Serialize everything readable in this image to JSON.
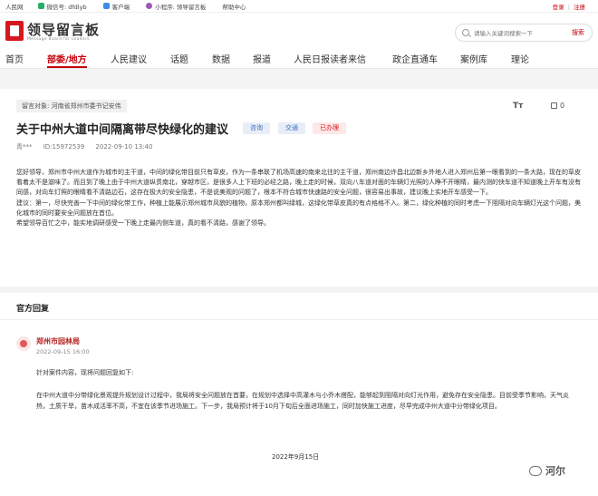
{
  "topbar": {
    "items": [
      "人民网",
      "微信号: dfdlyb",
      "客户端",
      "小程序: 领导留言板",
      "帮助中心"
    ],
    "login": "登录",
    "register": "注册"
  },
  "logo": {
    "title": "领导留言板",
    "subtitle": "Message Board for Leaders"
  },
  "search": {
    "placeholder": "请输入关键词搜索一下",
    "button": "搜索"
  },
  "nav": [
    "首页",
    "部委/地方",
    "人民建议",
    "话题",
    "数据",
    "报道",
    "人民日报读者来信",
    "政企直通车",
    "案例库",
    "理论"
  ],
  "nav_active": "部委/地方",
  "post": {
    "target": "留言对象: 河南省郑州市委书记安伟",
    "title": "关于中州大道中间隔离带尽快绿化的建议",
    "tags": {
      "category1": "咨询",
      "category2": "交通",
      "status": "已办理"
    },
    "font_icon": "Tт",
    "likes": "0",
    "author": "青***",
    "id": "ID:15972539",
    "date": "2022-09-10 13:40",
    "paragraphs": [
      "您好领导，郑州市中州大道作为城市的主干道，中间的绿化带目前只有草皮，作为一条串联了机场高速的南来北往的主干道，郑州南边许昌北边新乡外地人进入郑州后第一眼看到的一条大路，现在的草皮看着太不是滋味了。而且到了晚上由于中州大道纵贯南北，穿越市区，是很多人上下班的必经之路，晚上走的时候，双向八车道对面的车辆灯光照的人睁不开眼睛，最内测的快车道不知道晚上开车有没有同感，对向车灯照的眼睛看不清路边石，这存在极大的安全隐患，不是说美观的问题了，根本不符合城市快速路的安全问题，很容易出事故，建议晚上实地开车感受一下。",
      "建议：第一，尽快完善一下中间的绿化带工作，种植上能展示郑州城市风貌的植物，原本郑州都叫绿城，这绿化带草皮真的有点格格不入。第二，绿化种植的同时考虑一下阻隔对向车辆灯光这个问题，美化城市的同时要安全问题放在首位。",
      "希望领导百忙之中，能实地调研感受一下晚上走最内侧车道，真的看不清路，感谢了领导。"
    ]
  },
  "reply": {
    "heading": "官方回复",
    "org": "郑州市园林局",
    "date": "2022-09-15 16:00",
    "intro": "针对案件内容，现将问题回复如下:",
    "content": "在中州大道中分带绿化景观提升规划设计过程中，我局将安全问题放在首要，在规划中选择中高灌木与小乔木搭配，能够起到阻隔对向灯光作用，避免存在安全隐患。目前受季节影响，天气炎热，土质干旱，苗木成活率不高，不宜在该季节进场施工。下一步，我局预计将于10月下旬后全面进场施工，同时加快施工进度，尽早完成中州大道中分带绿化项目。",
    "sign_date": "2022年9月15日"
  },
  "watermark": "河尔"
}
